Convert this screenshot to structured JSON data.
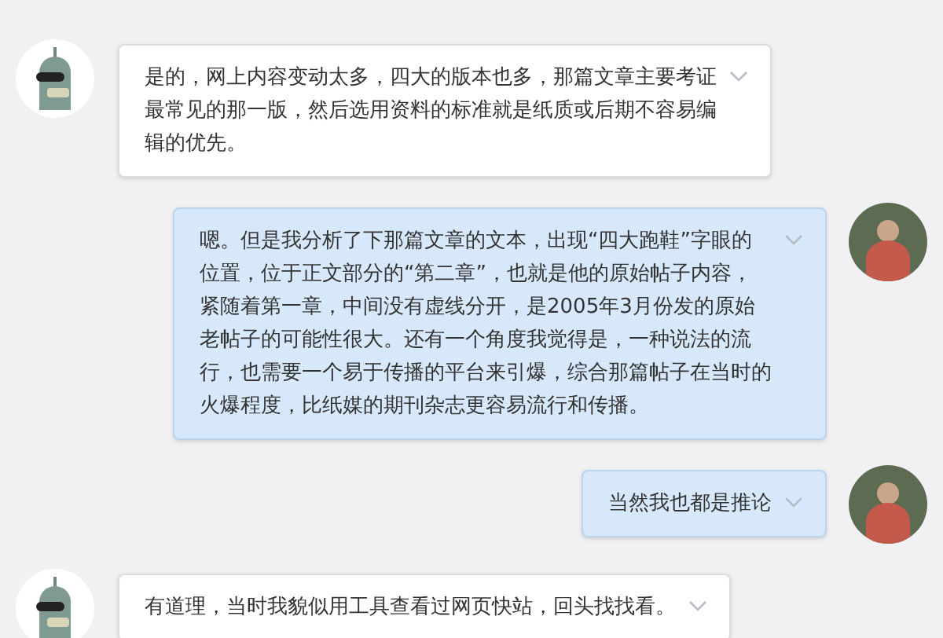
{
  "messages": [
    {
      "kind": "incoming",
      "text": "是的，网上内容变动太多，四大的版本也多，那篇文章主要考证最常见的那一版，然后选用资料的标准就是纸质或后期不容易编辑的优先。"
    },
    {
      "kind": "outgoing",
      "text": "嗯。但是我分析了下那篇文章的文本，出现“四大跑鞋”字眼的位置，位于正文部分的“第二章”，也就是他的原始帖子内容，紧随着第一章，中间没有虚线分开，是2005年3月份发的原始老帖子的可能性很大。还有一个角度我觉得是，一种说法的流行，也需要一个易于传播的平台来引爆，综合那篇帖子在当时的火爆程度，比纸媒的期刊杂志更容易流行和传播。"
    },
    {
      "kind": "outgoing",
      "text": "当然我也都是推论"
    },
    {
      "kind": "incoming",
      "text": "有道理，当时我貌似用工具查看过网页快站，回头找找看。"
    }
  ]
}
